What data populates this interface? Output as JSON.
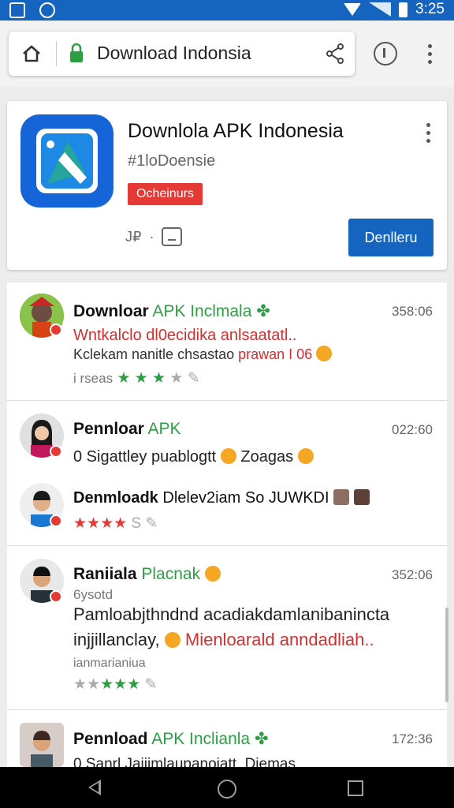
{
  "status_bar": {
    "time": "3:25"
  },
  "browser": {
    "url": "Download Indonsia"
  },
  "app": {
    "title": "Downlola APK Indonesia",
    "subtitle": "#1loDoensie",
    "badge": "Ocheinurs",
    "meta_icon": "J₽",
    "install_label": "Denlleru",
    "brand_color": "#1565c0"
  },
  "reviews": [
    {
      "name_bold": "Downloar",
      "name_green": " APK Inclmala",
      "name_tail": " ✤",
      "time": "358:06",
      "lines": [
        {
          "text": "Wntkalclo dl0ecidika anlsaatatl..",
          "style": "red"
        },
        {
          "pre": "Kclekam nanitle chsastao ",
          "red": "prawan I 06"
        }
      ],
      "rating_label": "i rseas",
      "stars": "★ ★ ★",
      "stars_off": "★",
      "star_icons": "✎"
    },
    {
      "name_bold": "Pennloar",
      "name_green": " APK",
      "name_tail": "",
      "time": "022:60",
      "lines": [
        {
          "text": "0 Sigattley puablogtt ",
          "tail": " Zoagas "
        }
      ]
    },
    {
      "name_bold": "Denmloadk",
      "name_green": "",
      "name_tail": " Dlelev2iam So JUWKDI",
      "time": "",
      "rating_label": "",
      "stars": "★★★★",
      "stars_off": "S",
      "star_icons": "✎"
    },
    {
      "name_bold": "Raniiala",
      "name_green": " Placnak",
      "name_tail": "",
      "time": "352:06",
      "sub": "6ysotd",
      "lines": [
        {
          "text": "Pamloabjthndnd acadiakdamlanibanincta"
        },
        {
          "pre": "injjillanclay, ",
          "red": "Mienloarald anndadliah.."
        }
      ],
      "rating_label": "ianmarianiua",
      "stars": "★★★",
      "stars_off": "★★",
      "star_icons": "✎"
    },
    {
      "name_bold": "Pennload",
      "name_green": " APK Inclianla",
      "name_tail": " ✤",
      "time": "172:36",
      "lines": [
        {
          "text": "0 Sanrl Jaiiimlaupanoiatt, Diemas"
        }
      ]
    }
  ]
}
